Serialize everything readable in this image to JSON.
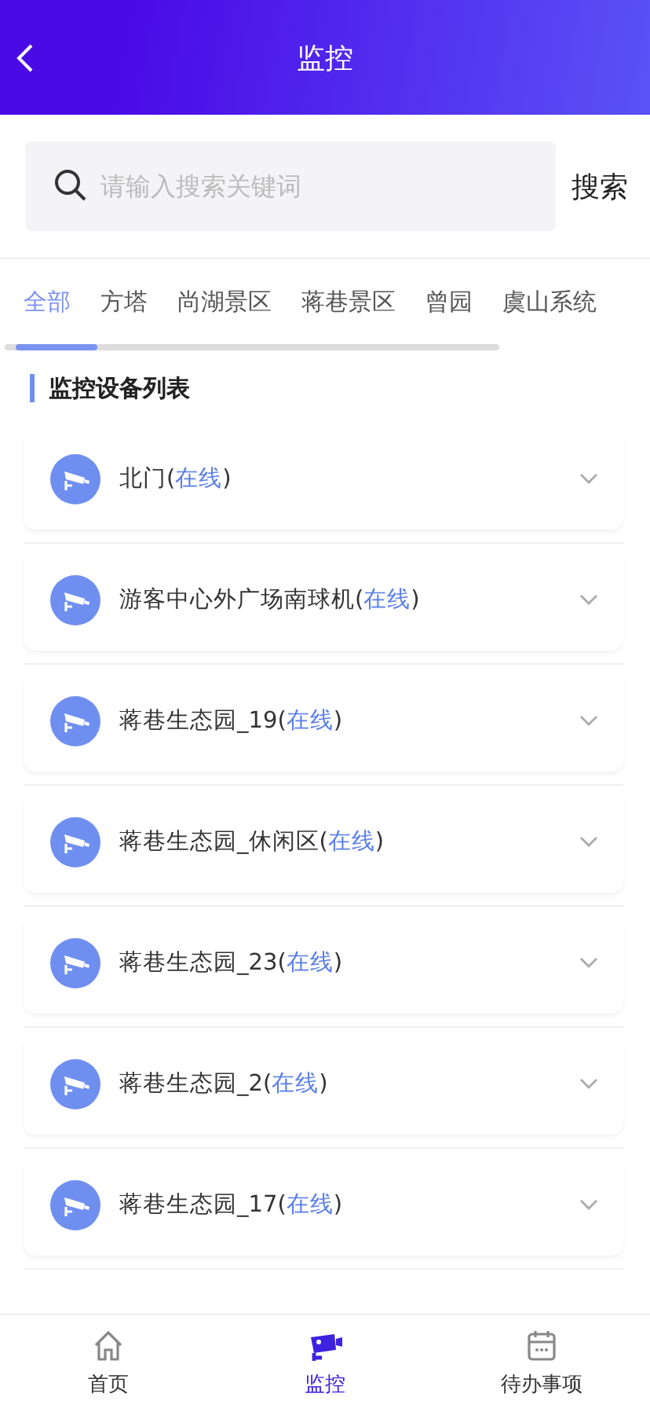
{
  "header": {
    "title": "监控"
  },
  "search": {
    "placeholder": "请输入搜索关键词",
    "button": "搜索"
  },
  "tabs": [
    {
      "label": "全部",
      "selected": true
    },
    {
      "label": "方塔",
      "selected": false
    },
    {
      "label": "尚湖景区",
      "selected": false
    },
    {
      "label": "蒋巷景区",
      "selected": false
    },
    {
      "label": "曾园",
      "selected": false
    },
    {
      "label": "虞山系统",
      "selected": false
    }
  ],
  "section_title": "监控设备列表",
  "devices": [
    {
      "name": "北门",
      "status": "(在线)"
    },
    {
      "name": "游客中心外广场南球机",
      "status": "(在线)"
    },
    {
      "name": "蒋巷生态园_19",
      "status": "(在线)"
    },
    {
      "name": "蒋巷生态园_休闲区",
      "status": "(在线)"
    },
    {
      "name": "蒋巷生态园_23",
      "status": "(在线)"
    },
    {
      "name": "蒋巷生态园_2",
      "status": "(在线)"
    },
    {
      "name": "蒋巷生态园_17",
      "status": "(在线)"
    }
  ],
  "bottom_nav": [
    {
      "label": "首页",
      "kind": "home",
      "selected": false
    },
    {
      "label": "监控",
      "kind": "camera",
      "selected": true
    },
    {
      "label": "待办事项",
      "kind": "calendar",
      "selected": false
    }
  ]
}
